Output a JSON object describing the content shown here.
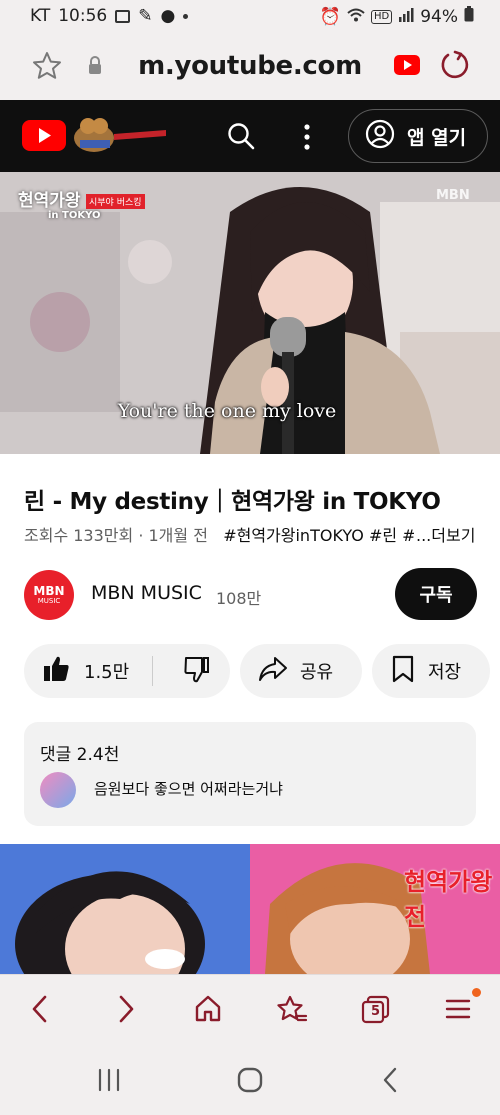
{
  "status_bar": {
    "carrier": "KT",
    "time": "10:56",
    "battery": "94%",
    "network_badge": "HD"
  },
  "browser": {
    "url": "m.youtube.com",
    "tab_count": "5"
  },
  "youtube_header": {
    "open_app_label": "앱 열기"
  },
  "video": {
    "overlay_logo": "현역가왕",
    "overlay_sub": "in TOKYO",
    "overlay_tag": "시부야 버스킹",
    "channel_watermark": "MBN",
    "subtitle": "You're the one my love"
  },
  "details": {
    "title": "린 - My destiny｜현역가왕 in TOKYO",
    "views": "조회수 133만회",
    "age": "1개월 전",
    "hashtags": "#현역가왕inTOKYO #린 #",
    "more_label": "...더보기"
  },
  "channel": {
    "avatar_text": "MBN",
    "avatar_subtext": "MUSIC",
    "name": "MBN MUSIC",
    "subscribers": "108만",
    "subscribe_label": "구독"
  },
  "actions": {
    "like_count": "1.5만",
    "share_label": "공유",
    "save_label": "저장"
  },
  "comments": {
    "header": "댓글 2.4천",
    "first_comment": "음원보다 좋으면 어쩌라는거냐"
  },
  "next_video": {
    "overlay_logo": "현역가왕전"
  },
  "colors": {
    "youtube_red": "#ff0000",
    "browser_accent": "#8a1c2b",
    "mbn_red": "#e8202a"
  }
}
